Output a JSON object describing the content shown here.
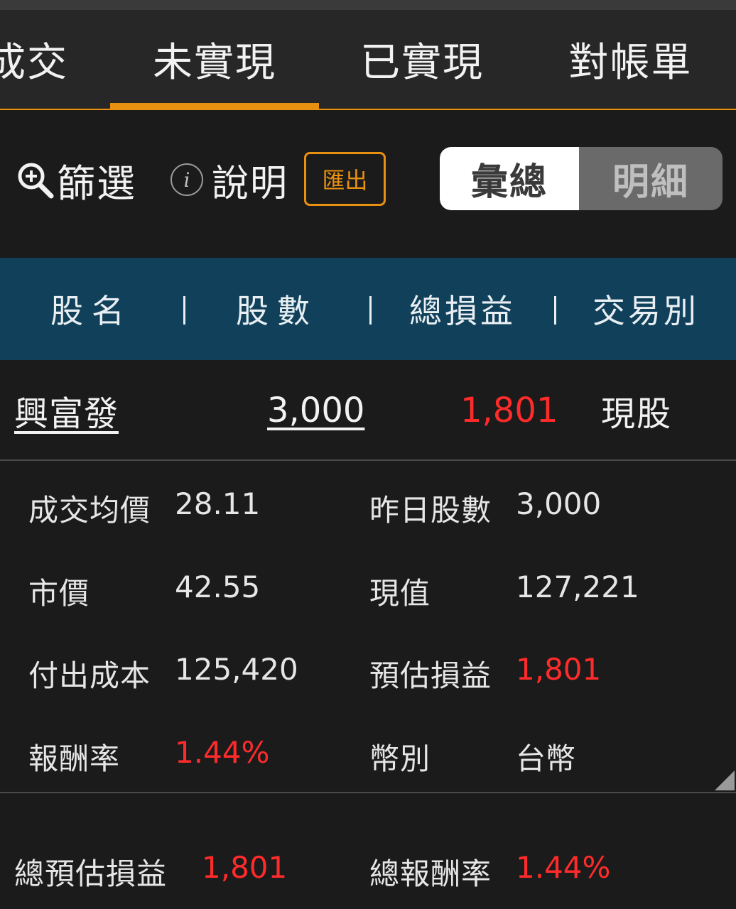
{
  "tabs": [
    {
      "label": "成交",
      "active": false
    },
    {
      "label": "未實現",
      "active": true
    },
    {
      "label": "已實現",
      "active": false
    },
    {
      "label": "對帳單",
      "active": false
    }
  ],
  "toolbar": {
    "filter_label": "篩選",
    "filter_icon": "search-zoom-icon",
    "help_label": "說明",
    "help_icon": "info-icon",
    "info_glyph": "i",
    "export_label": "匯出",
    "view_toggle": [
      {
        "label": "彙總",
        "selected": true
      },
      {
        "label": "明細",
        "selected": false
      }
    ]
  },
  "table_header": [
    "股名",
    "股數",
    "總損益",
    "交易別"
  ],
  "position": {
    "name": "興富發",
    "quantity": "3,000",
    "total_pl": "1,801",
    "trade_type": "現股"
  },
  "details": {
    "avg_price_label": "成交均價",
    "avg_price": "28.11",
    "prev_shares_label": "昨日股數",
    "prev_shares": "3,000",
    "market_price_label": "市價",
    "market_price": "42.55",
    "market_value_label": "現值",
    "market_value": "127,221",
    "cost_label": "付出成本",
    "cost": "125,420",
    "est_pl_label": "預估損益",
    "est_pl": "1,801",
    "return_label": "報酬率",
    "return_rate": "1.44%",
    "currency_label": "幣別",
    "currency": "台幣"
  },
  "summary": {
    "total_est_pl_label": "總預估損益",
    "total_est_pl": "1,801",
    "total_return_label": "總報酬率",
    "total_return": "1.44%"
  },
  "colors": {
    "accent": "#e8900f",
    "loss_gain_red": "#ff2b2b",
    "header_bg": "#10405a",
    "background": "#1b1b1b"
  }
}
